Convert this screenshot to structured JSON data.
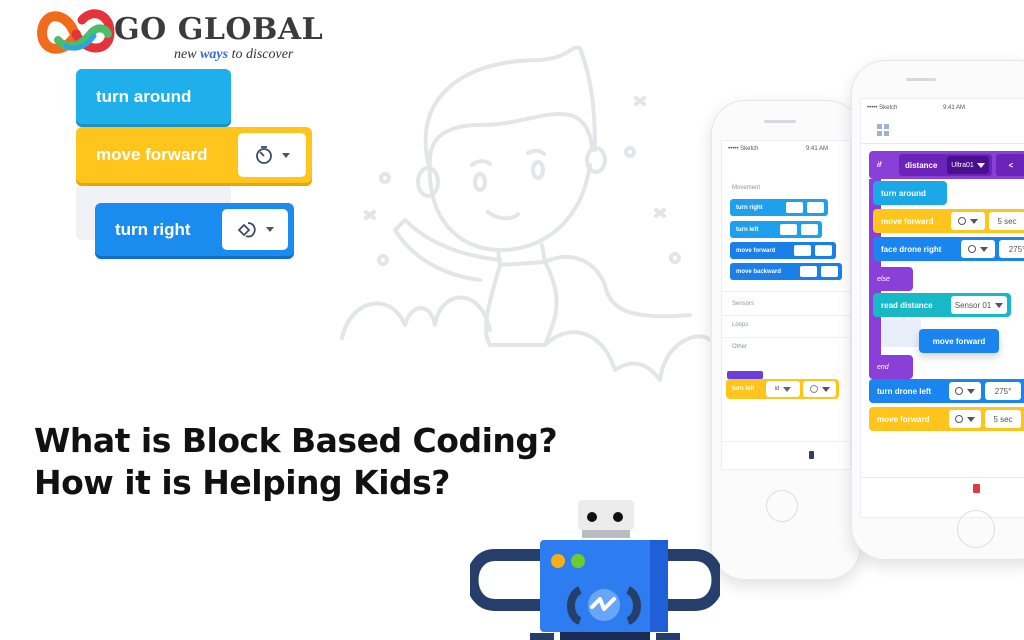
{
  "brand": {
    "title": "GO GLOBAL",
    "tagline_pre": "new ",
    "tagline_em": "ways",
    "tagline_post": " to discover",
    "colors": {
      "orange": "#f26b1d",
      "red": "#e63339",
      "green": "#4cbb6c",
      "blue": "#2f6fd6",
      "text": "#3b3b3b"
    }
  },
  "headline": {
    "line1": "What is Block Based Coding?",
    "line2": "How it is Helping Kids?"
  },
  "featured_blocks": [
    {
      "label": "turn around",
      "color": "#1fb0ec"
    },
    {
      "label": "move forward",
      "color": "#ffc51c",
      "icon": "timer-icon"
    },
    {
      "label": "turn right",
      "color": "#1a8cf0",
      "icon": "rotate-icon"
    }
  ],
  "phone_left": {
    "status_carrier": "••••• Sketch",
    "status_time": "9:41 AM",
    "section_movement": "Movement",
    "palette": [
      "turn right",
      "turn left",
      "move forward",
      "move backward"
    ],
    "sections": [
      "Sensors",
      "Loops",
      "Other"
    ],
    "dragged_block": {
      "label": "turn left",
      "field1": "id"
    }
  },
  "phone_right": {
    "status_carrier": "••••• Sketch",
    "status_time": "9:41 AM",
    "program": {
      "if_label": "if",
      "condition": "distance",
      "sensor": "Ultra01",
      "operator": "<",
      "rows": [
        {
          "label": "turn around"
        },
        {
          "label": "move forward",
          "value": "5 sec"
        },
        {
          "label": "face drone right",
          "value": "275°"
        }
      ],
      "else_label": "else",
      "read_label": "read distance",
      "read_sensor": "Sensor 01",
      "nested": "move forward",
      "end_label": "end",
      "after": [
        {
          "label": "turn drone left",
          "value": "275°"
        },
        {
          "label": "move forward",
          "value": "5 sec"
        }
      ]
    }
  }
}
